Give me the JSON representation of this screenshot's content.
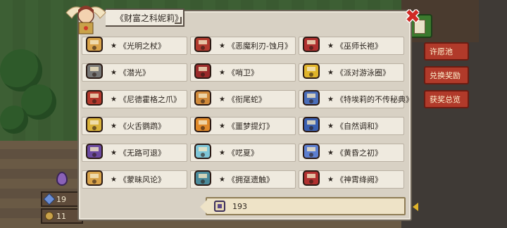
{
  "title": "《财富之科妮莉》",
  "close": "✖",
  "side_menu": [
    "许愿池",
    "兑换奖励",
    "获奖总览"
  ],
  "resources": [
    {
      "value": "19",
      "kind": "gem"
    },
    {
      "value": "11",
      "kind": "coin"
    }
  ],
  "items": [
    [
      {
        "name": "《光明之杖》",
        "icon": "staff-icon",
        "color": "#d9a34a"
      },
      {
        "name": "《恶魔利刃-蚀月》",
        "icon": "blade-icon",
        "color": "#b23a2e"
      },
      {
        "name": "《巫师长袍》",
        "icon": "robe-icon",
        "color": "#b0302f"
      }
    ],
    [
      {
        "name": "《潜光》",
        "icon": "scythe-icon",
        "color": "#777777"
      },
      {
        "name": "《哨卫》",
        "icon": "helmet-icon",
        "color": "#9a2a2a"
      },
      {
        "name": "《派对游泳圈》",
        "icon": "anchor-icon",
        "color": "#e0b42a"
      }
    ],
    [
      {
        "name": "《尼德霍格之爪》",
        "icon": "claw-icon",
        "color": "#b3382c"
      },
      {
        "name": "《衔尾蛇》",
        "icon": "ouroboros-icon",
        "color": "#d08a3a"
      },
      {
        "name": "《特埃莉的不传秘典》",
        "icon": "tome-icon",
        "color": "#4a6db8"
      }
    ],
    [
      {
        "name": "《火舌鹦鹉》",
        "icon": "flame-gun-icon",
        "color": "#d9b23a"
      },
      {
        "name": "《噩梦提灯》",
        "icon": "lantern-icon",
        "color": "#e08a2a"
      },
      {
        "name": "《自然调和》",
        "icon": "armor-icon",
        "color": "#3a5fb0"
      }
    ],
    [
      {
        "name": "《无路可退》",
        "icon": "cloak-icon",
        "color": "#6b4aa0"
      },
      {
        "name": "《呓夏》",
        "icon": "water-gun-icon",
        "color": "#7ec6d8"
      },
      {
        "name": "《黄昏之初》",
        "icon": "ring-icon",
        "color": "#5d7fd0"
      }
    ],
    [
      {
        "name": "《蒙昧风论》",
        "icon": "bracelet-icon",
        "color": "#d9a34a"
      },
      {
        "name": "《拥趸遗触》",
        "icon": "tentacle-icon",
        "color": "#4a8a9a"
      },
      {
        "name": "《神霄绛阙》",
        "icon": "amulet-icon",
        "color": "#b0302f"
      }
    ]
  ],
  "star": "★",
  "collection_count": "193"
}
